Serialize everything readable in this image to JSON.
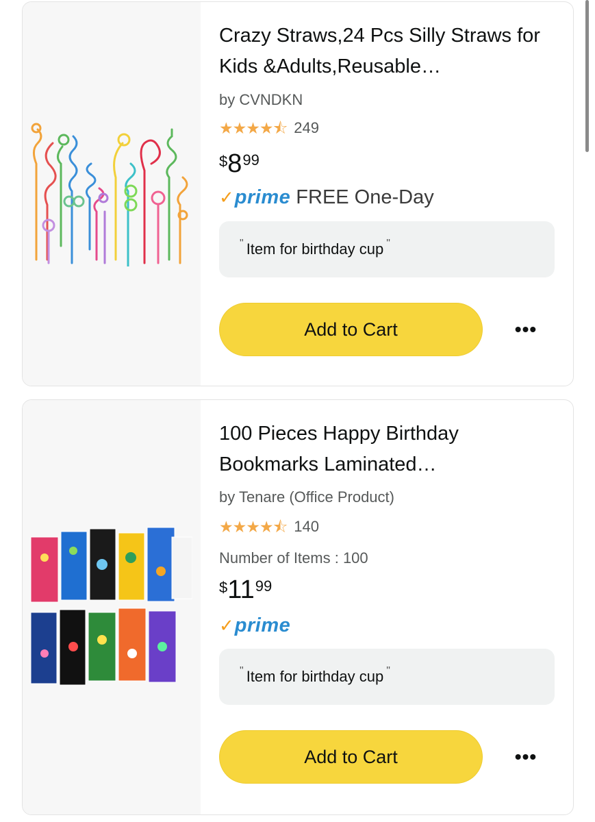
{
  "products": [
    {
      "title": "Crazy Straws,24 Pcs Silly Straws for Kids &Adults,Reusable…",
      "byline": "by CVNDKN",
      "rating_stars": 4.5,
      "rating_count": "249",
      "price_symbol": "$",
      "price_whole": "8",
      "price_fraction": "99",
      "prime_label": "prime",
      "delivery": "FREE One-Day",
      "note": "Item for birthday cup",
      "add_to_cart": "Add to Cart",
      "image_icon": "crazy-straws-product-image"
    },
    {
      "title": "100 Pieces Happy Birthday Bookmarks Laminated…",
      "byline": "by Tenare (Office Product)",
      "rating_stars": 4.5,
      "rating_count": "140",
      "items_label": "Number of Items : 100",
      "price_symbol": "$",
      "price_whole": "11",
      "price_fraction": "99",
      "prime_label": "prime",
      "note": "Item for birthday cup",
      "add_to_cart": "Add to Cart",
      "image_icon": "birthday-bookmarks-product-image"
    }
  ],
  "colors": {
    "cart_button": "#f7d63d",
    "prime_blue": "#2a8cd0",
    "prime_check": "#f59e1c",
    "star": "#f3a847"
  }
}
